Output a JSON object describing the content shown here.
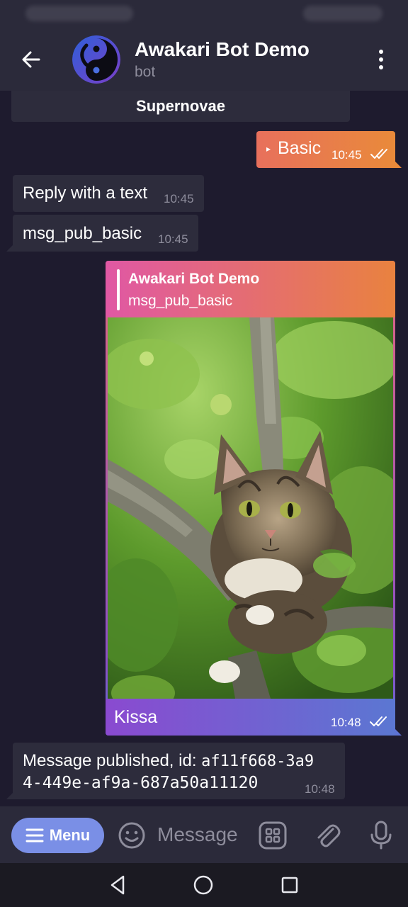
{
  "header": {
    "title": "Awakari Bot Demo",
    "subtitle": "bot",
    "icons": {
      "back": "arrow-left-icon",
      "more": "more-vertical-icon",
      "avatar": "yin-yang-logo"
    }
  },
  "messages": {
    "partial_button": "Supernovae",
    "out_basic": {
      "prefix": "▸",
      "text": "Basic",
      "time": "10:45"
    },
    "in_reply": {
      "text": "Reply with a text",
      "time": "10:45"
    },
    "in_pub": {
      "text": "msg_pub_basic",
      "time": "10:45"
    },
    "photo_msg": {
      "reply_name": "Awakari Bot Demo",
      "reply_text": "msg_pub_basic",
      "caption": "Kissa",
      "time": "10:48"
    },
    "in_published": {
      "text_prefix": "Message published, id: ",
      "id_part1": "af11f668-3a9",
      "id_part2": "4-449e-af9a-687a50a11120",
      "time": "10:48"
    }
  },
  "input_bar": {
    "menu_label": "Menu",
    "placeholder": "Message",
    "icons": {
      "menu": "menu-lines-icon",
      "emoji": "emoji-icon",
      "apps": "apps-grid-icon",
      "attach": "paperclip-icon",
      "mic": "microphone-icon"
    }
  },
  "colors": {
    "background": "#1e1b2e",
    "header": "#2b2a3a",
    "incoming_bubble": "#2d2c3c",
    "outgoing_gradient_start": "#e8705c",
    "outgoing_gradient_end": "#e98a3a",
    "menu_button": "#7a8fe6",
    "muted_text": "#8e8d9c"
  }
}
